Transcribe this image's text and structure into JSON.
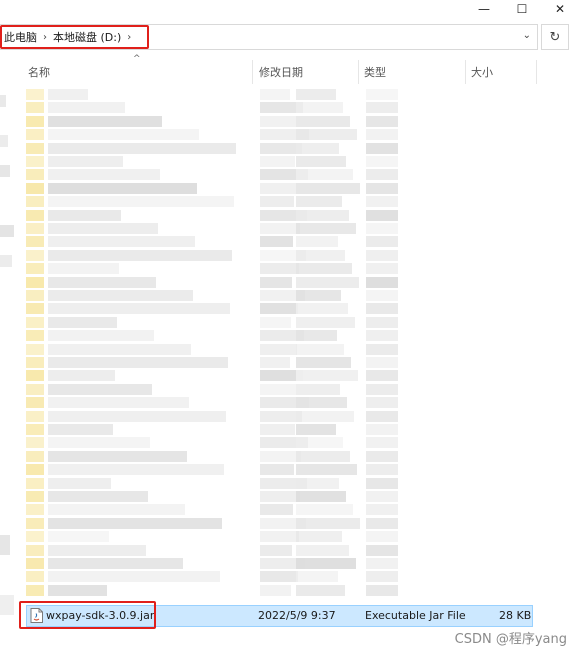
{
  "window": {
    "minimize_glyph": "—",
    "maximize_glyph": "☐",
    "close_glyph": "✕"
  },
  "address_bar": {
    "crumbs": [
      "此电脑",
      "本地磁盘 (D:)"
    ],
    "separator": "›",
    "dropdown_glyph": "⌄",
    "refresh_glyph": "↻"
  },
  "columns": {
    "name": "名称",
    "date": "修改日期",
    "type": "类型",
    "size": "大小",
    "sort_glyph": "^"
  },
  "selected_file": {
    "name": "wxpay-sdk-3.0.9.jar",
    "date": "2022/5/9 9:37",
    "type": "Executable Jar File",
    "size": "28 KB",
    "icon": "jar-file-icon"
  },
  "watermark": "CSDN @程序yang",
  "colors": {
    "highlight_bg": "#cce8ff",
    "highlight_border": "#99d1ff",
    "annotation_red": "#e0201b",
    "folder_yellow": "#f7e7a6"
  }
}
